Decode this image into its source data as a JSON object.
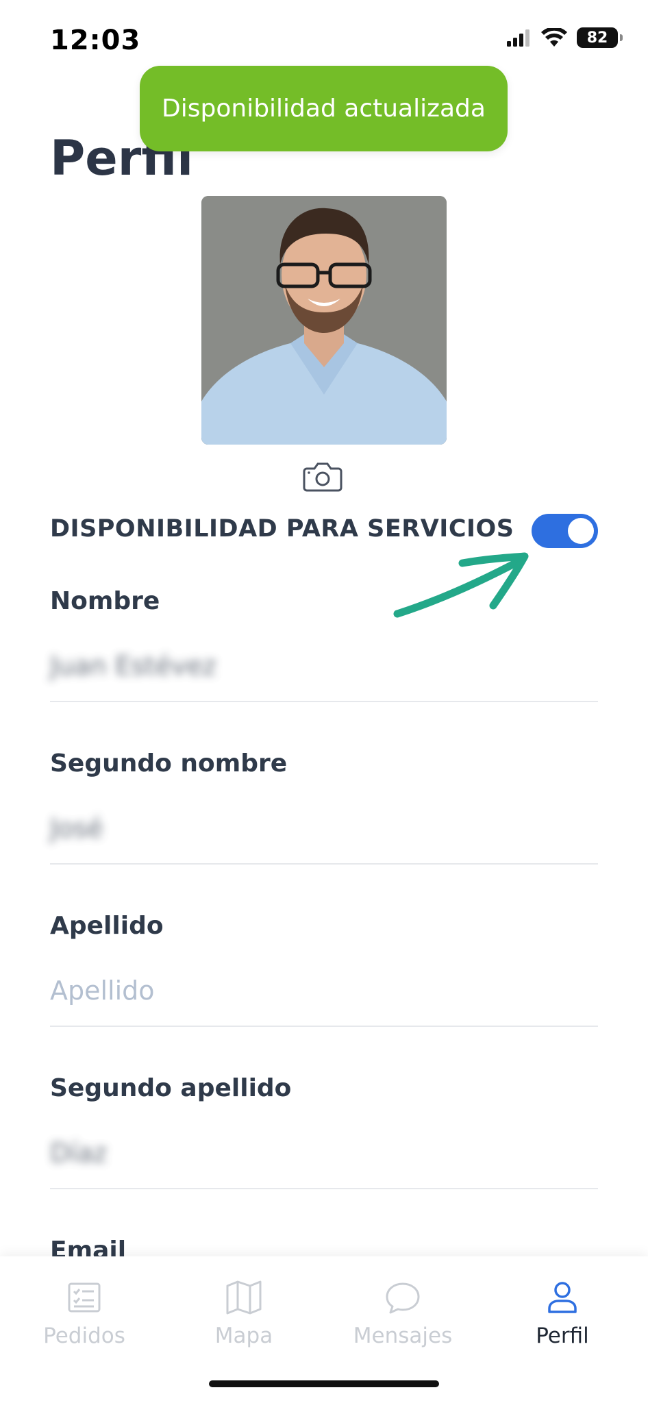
{
  "status_bar": {
    "time": "12:03",
    "battery_level": "82",
    "icons": [
      "cellular-signal-icon",
      "wifi-icon",
      "battery-icon"
    ]
  },
  "toast": {
    "message": "Disponibilidad actualizada",
    "color": "#74bd28"
  },
  "page": {
    "title": "Perfil"
  },
  "profile": {
    "photo": "profile-photo",
    "change_photo_icon": "camera-icon"
  },
  "availability": {
    "label": "DISPONIBILIDAD PARA SERVICIOS",
    "enabled": true,
    "toggle_color": "#2e6fe0"
  },
  "form": {
    "fields": [
      {
        "label": "Nombre",
        "value": "Juan Estévez",
        "blurred": true
      },
      {
        "label": "Segundo nombre",
        "value": "José",
        "blurred": true
      },
      {
        "label": "Apellido",
        "value": "",
        "placeholder": "Apellido"
      },
      {
        "label": "Segundo apellido",
        "value": "Díaz",
        "blurred": true
      },
      {
        "label": "Email"
      }
    ]
  },
  "tabbar": {
    "items": [
      {
        "label": "Pedidos",
        "icon": "checklist-icon",
        "active": false
      },
      {
        "label": "Mapa",
        "icon": "map-icon",
        "active": false
      },
      {
        "label": "Mensajes",
        "icon": "chat-bubble-icon",
        "active": false
      },
      {
        "label": "Perfil",
        "icon": "user-icon",
        "active": true
      }
    ],
    "active_color": "#2e6fe0",
    "inactive_color": "#c9cdd3"
  }
}
